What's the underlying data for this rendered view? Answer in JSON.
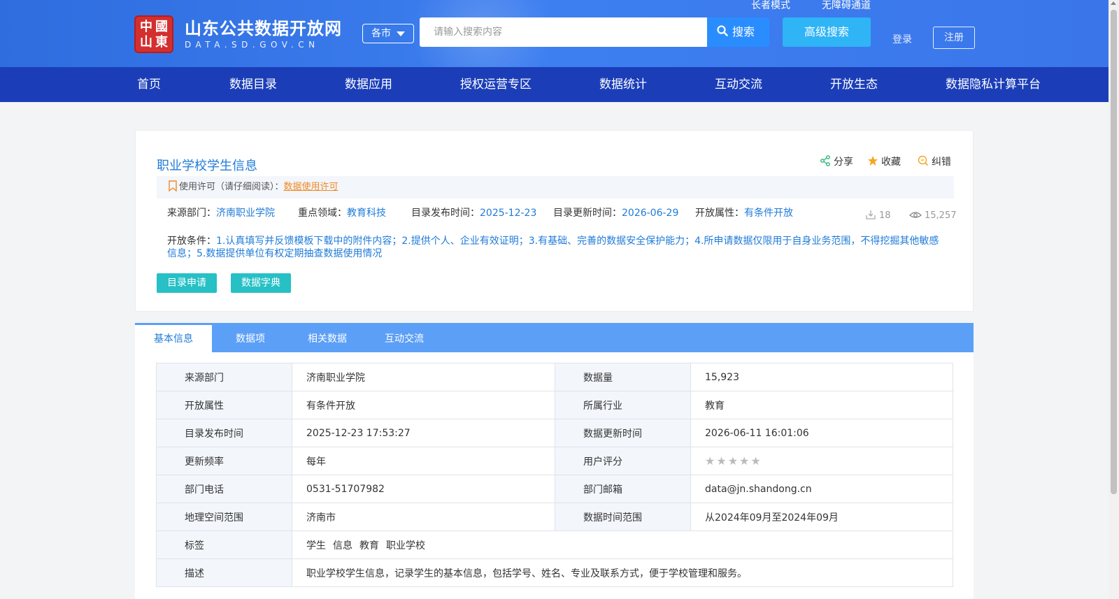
{
  "header": {
    "logo_chars": [
      "中",
      "國",
      "山",
      "東"
    ],
    "site_name": "山东公共数据开放网",
    "site_domain": "DATA.SD.GOV.CN",
    "region_label": "各市",
    "search_placeholder": "请输入搜索内容",
    "search_button": "搜索",
    "advanced_search": "高级搜索",
    "elder_mode": "长者模式",
    "accessibility": "无障碍通道",
    "login": "登录",
    "register": "注册"
  },
  "nav": [
    "首页",
    "数据目录",
    "数据应用",
    "授权运营专区",
    "数据统计",
    "互动交流",
    "开放生态",
    "数据隐私计算平台"
  ],
  "detail": {
    "title": "职业学校学生信息",
    "actions": {
      "share": "分享",
      "favorite": "收藏",
      "report": "纠错"
    },
    "license_label": "使用许可（请仔细阅读）：",
    "license_link": "数据使用许可",
    "meta": {
      "source_label": "来源部门：",
      "source_value": "济南职业学院",
      "domain_label": "重点领域：",
      "domain_value": "教育科技",
      "publish_label": "目录发布时间：",
      "publish_value": "2025-12-23",
      "update_label": "目录更新时间：",
      "update_value": "2026-06-29",
      "open_label": "开放属性：",
      "open_value": "有条件开放"
    },
    "downloads": "18",
    "views": "15,257",
    "condition_label": "开放条件：",
    "condition_text": "1.认真填写并反馈模板下载中的附件内容；2.提供个人、企业有效证明；3.有基础、完善的数据安全保护能力；4.所申请数据仅限用于自身业务范围，不得挖掘其他敏感信息；5.数据提供单位有权定期抽查数据使用情况",
    "apply_button": "目录申请",
    "dictionary_button": "数据字典"
  },
  "tabs": [
    "基本信息",
    "数据项",
    "相关数据",
    "互动交流"
  ],
  "info": {
    "source_dept_label": "来源部门",
    "source_dept": "济南职业学院",
    "data_volume_label": "数据量",
    "data_volume": "15,923",
    "open_attr_label": "开放属性",
    "open_attr": "有条件开放",
    "industry_label": "所属行业",
    "industry": "教育",
    "publish_time_label": "目录发布时间",
    "publish_time": "2025-12-23 17:53:27",
    "update_time_label": "数据更新时间",
    "update_time": "2026-06-11 16:01:06",
    "frequency_label": "更新频率",
    "frequency": "每年",
    "rating_label": "用户评分",
    "rating": 0,
    "phone_label": "部门电话",
    "phone": "0531-51707982",
    "email_label": "部门邮箱",
    "email": "data@jn.shandong.cn",
    "geo_label": "地理空间范围",
    "geo": "济南市",
    "time_range_label": "数据时间范围",
    "time_range": "从2024年09月至2024年09月",
    "tags_label": "标签",
    "tags": [
      "学生",
      "信息",
      "教育",
      "职业学校"
    ],
    "desc_label": "描述",
    "desc": "职业学校学生信息，记录学生的基本信息，包括学号、姓名、专业及联系方式，便于学校管理和服务。"
  },
  "colors": {
    "nav_bg": "#1b3eb8",
    "accent": "#1f7bd8",
    "teal": "#26c0c5",
    "tabs_bg": "#5c9ff7"
  }
}
